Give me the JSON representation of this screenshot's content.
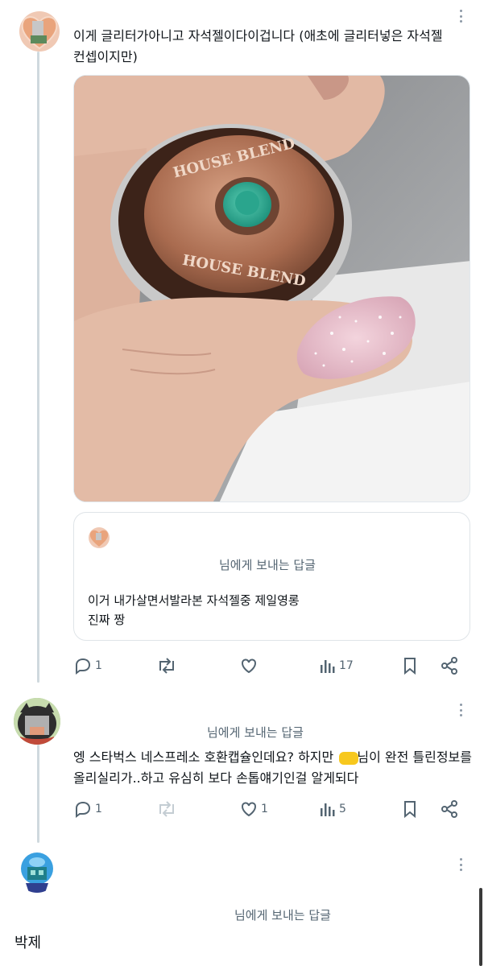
{
  "post": {
    "text_line1": "이게 글리터가아니고 자석젤이다이겁니다 (애초에 글리터넣은 자석젤",
    "text_line2": "컨셉이지만)",
    "photo": {
      "capsule_text_top": "HOUSE BLEND",
      "capsule_text_bottom": "HOUSE BLEND"
    },
    "quote": {
      "reply_to": "님에게 보내는 답글",
      "line1": "이거 내가살면서발라본 자석젤중 제일영롱",
      "line2": "진짜 짱"
    },
    "actions": {
      "replies": "1",
      "reposts": "",
      "likes": "",
      "views": "17"
    }
  },
  "reply1": {
    "reply_to": "님에게 보내는 답글",
    "line1_a": "엥 스타벅스 네스프레소 호환캡슐인데요? 하지만",
    "line1_b": "님이 완전 틀린정보를",
    "line2": "올리실리가..하고 유심히 보다 손톱얘기인걸 알게되다",
    "actions": {
      "replies": "1",
      "reposts": "",
      "likes": "1",
      "views": "5"
    }
  },
  "reply2": {
    "reply_to": "님에게 보내는 답글"
  },
  "footer": {
    "caption": "박제"
  },
  "colors": {
    "text": "#0f1419",
    "secondary": "#536471",
    "thread_line": "#cfd9de"
  }
}
